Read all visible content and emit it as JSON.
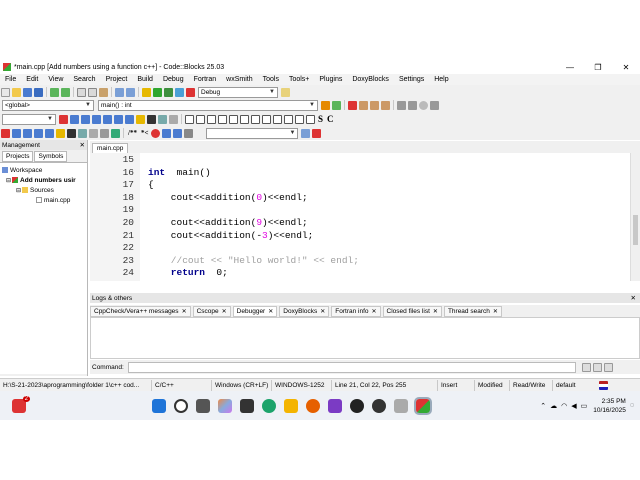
{
  "window": {
    "title": "*main.cpp [Add numbers using a function c++] - Code::Blocks 25.03",
    "minimize_glyph": "—",
    "maximize_glyph": "❐",
    "close_glyph": "✕"
  },
  "menu": [
    "File",
    "Edit",
    "View",
    "Search",
    "Project",
    "Build",
    "Debug",
    "Fortran",
    "wxSmith",
    "Tools",
    "Tools+",
    "Plugins",
    "DoxyBlocks",
    "Settings",
    "Help"
  ],
  "toolbar": {
    "build_target": "Debug",
    "scope": "<global>",
    "function": "main() : int",
    "search_combo": ""
  },
  "management": {
    "title": "Management",
    "tabs": [
      "Projects",
      "Symbols"
    ],
    "tree": {
      "workspace": "Workspace",
      "project": "Add numbers usir",
      "sources": "Sources",
      "file": "main.cpp"
    }
  },
  "editor": {
    "tab": "main.cpp",
    "lines": [
      {
        "n": "15",
        "html": ""
      },
      {
        "n": "16",
        "parts": [
          [
            "kw",
            "int"
          ],
          [
            "",
            "  main()"
          ]
        ]
      },
      {
        "n": "17",
        "parts": [
          [
            "",
            "{"
          ]
        ]
      },
      {
        "n": "18",
        "parts": [
          [
            "",
            "    cout<<addition("
          ],
          [
            "num",
            "0"
          ],
          [
            "",
            ")<<endl;"
          ]
        ]
      },
      {
        "n": "19",
        "parts": []
      },
      {
        "n": "20",
        "parts": [
          [
            "",
            "    cout<<addition("
          ],
          [
            "num",
            "9"
          ],
          [
            "",
            ")<<endl;"
          ]
        ]
      },
      {
        "n": "21",
        "parts": [
          [
            "",
            "    cout<<addition(-"
          ],
          [
            "num",
            "3"
          ],
          [
            "",
            ")<<endl;"
          ]
        ]
      },
      {
        "n": "22",
        "parts": []
      },
      {
        "n": "23",
        "parts": [
          [
            "cmt",
            "    //cout << \"Hello world!\" << endl;"
          ]
        ]
      },
      {
        "n": "24",
        "parts": [
          [
            "kw",
            "    return"
          ],
          [
            "",
            "  0;"
          ]
        ]
      }
    ]
  },
  "logs": {
    "title": "Logs & others",
    "tabs": [
      "CppCheck/Vera++ messages",
      "Cscope",
      "Debugger",
      "DoxyBlocks",
      "Fortran info",
      "Closed files list",
      "Thread search"
    ],
    "active_tab": "Debugger",
    "command_label": "Command:"
  },
  "status": {
    "path": "H:\\S-21-2023\\aprogramming\\folder 1\\c++ cod...",
    "language": "C/C++",
    "line_endings": "Windows (CR+LF)",
    "encoding": "WINDOWS-1252",
    "position": "Line 21, Col 22, Pos 255",
    "insert": "Insert",
    "modified": "Modified",
    "access": "Read/Write",
    "profile": "default"
  },
  "taskbar": {
    "time": "2:35 PM",
    "date": "10/16/2025",
    "notification_badge": "2"
  },
  "colors": {
    "keyword": "#00008b",
    "number": "#e000e0",
    "comment": "#a0a0a0"
  }
}
